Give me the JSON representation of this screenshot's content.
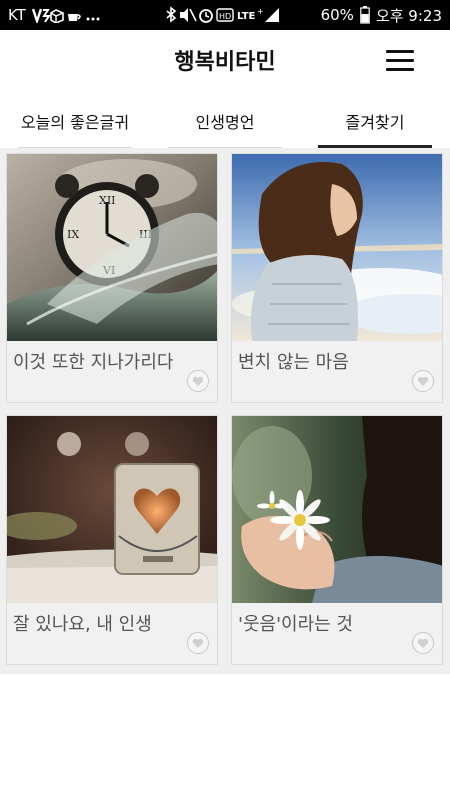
{
  "status_bar": {
    "carrier": "KT",
    "extra_icons": "V⁄ ⬡ ☕ …",
    "battery_percent": "60%",
    "time_label": "오후 9:23",
    "network": "LTE+"
  },
  "header": {
    "title": "행복비타민",
    "menu_icon": "hamburger-menu-icon"
  },
  "tabs": [
    {
      "label": "오늘의 좋은글귀",
      "active": false
    },
    {
      "label": "인생명언",
      "active": false
    },
    {
      "label": "즐겨찾기",
      "active": true
    }
  ],
  "cards": [
    {
      "caption": "이것 또한 지나가리다",
      "image": "clock-in-water"
    },
    {
      "caption": "변치 않는 마음",
      "image": "woman-above-clouds"
    },
    {
      "caption": "잘 있나요, 내 인생",
      "image": "heart-candle-holder"
    },
    {
      "caption": "'웃음'이라는 것",
      "image": "woman-holding-daisy"
    }
  ],
  "colors": {
    "accent_underline": "#222222",
    "grid_background": "#efefef",
    "caption_text": "#555555"
  }
}
